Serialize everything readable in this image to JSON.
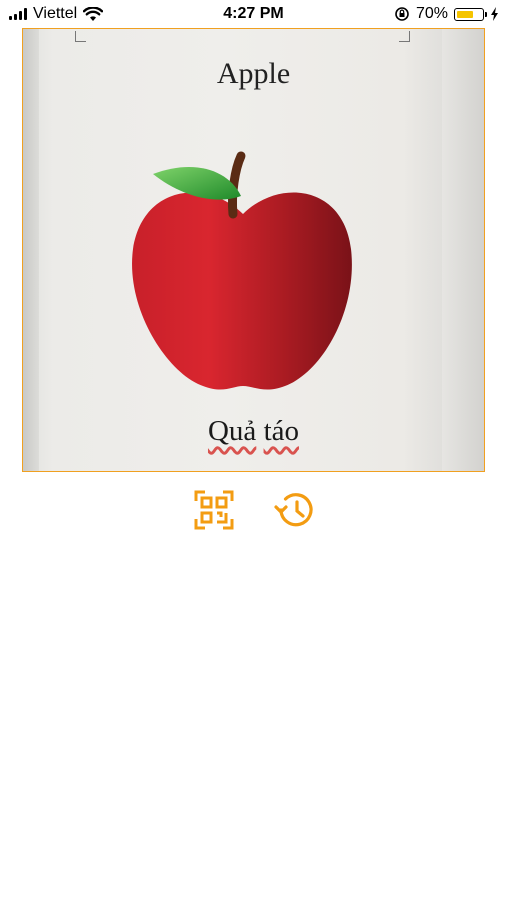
{
  "status_bar": {
    "carrier": "Viettel",
    "time": "4:27 PM",
    "battery_percent": "70%",
    "battery_level": 0.7
  },
  "scan": {
    "card_title": "Apple",
    "card_caption_word1": "Quả",
    "card_caption_word2": "táo"
  },
  "actions": {
    "scan_icon": "qr-scan-icon",
    "history_icon": "history-icon"
  },
  "colors": {
    "accent": "#F39C12",
    "frame_border": "#F0A020",
    "battery": "#F5C400"
  }
}
